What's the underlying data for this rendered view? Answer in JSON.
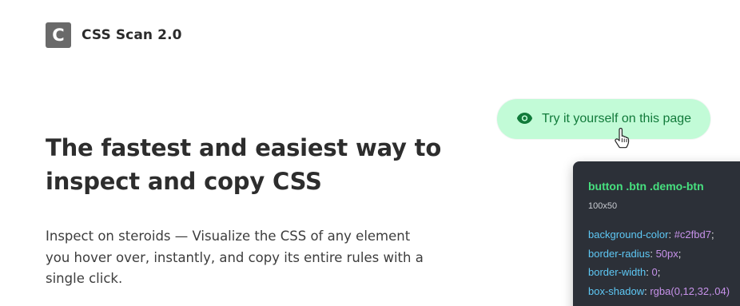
{
  "brand": {
    "logo_letter": "C",
    "name": "CSS Scan 2.0"
  },
  "hero": {
    "title_line1": "The fastest and easiest way to",
    "title_line2": "inspect and copy CSS",
    "subtitle_line1": "Inspect on steroids — Visualize the CSS of any element",
    "subtitle_line2": "you hover over, instantly, and copy its entire rules with a",
    "subtitle_line3": "single click."
  },
  "demo_button": {
    "label": "Try it yourself on this page",
    "icon": "eye-icon",
    "background": "#c2fbd7"
  },
  "cursor": {
    "icon": "hand-pointer-icon"
  },
  "inspector": {
    "selector_tag": "button",
    "selector_classes": " .btn .demo-btn",
    "size": "100x50",
    "rules": [
      {
        "prop": "background-color",
        "colon": ": ",
        "value": "#c2fbd7",
        "semi": ";"
      },
      {
        "prop": "border-radius",
        "colon": ": ",
        "value": "50px",
        "semi": ";"
      },
      {
        "prop": "border-width",
        "colon": ": ",
        "value": "0",
        "semi": ";"
      },
      {
        "prop": "box-shadow",
        "colon": ": ",
        "value": "rgba(0,12,32,.04)",
        "semi": ""
      }
    ],
    "colors": {
      "panel": "#2c3038",
      "selector": "#47e07f",
      "property": "#5ec8f5",
      "value": "#c792ea"
    }
  }
}
